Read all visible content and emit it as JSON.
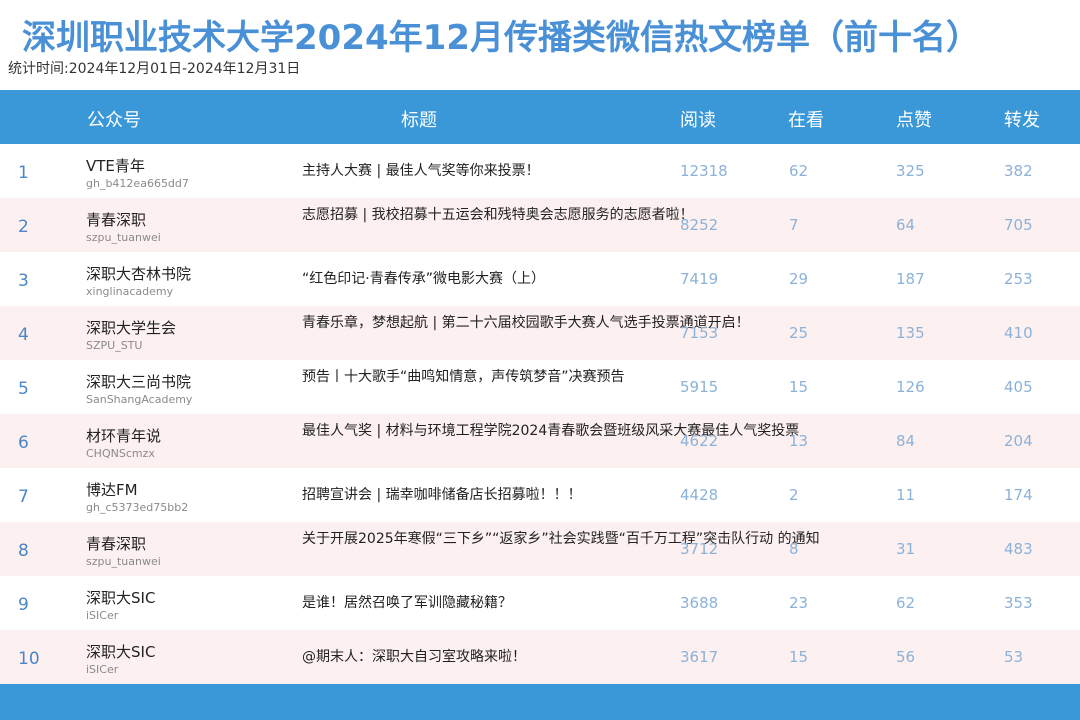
{
  "title": "深圳职业技术大学2024年12月传播类微信热文榜单（前十名）",
  "subtitle": "统计时间:2024年12月01日-2024年12月31日",
  "headers": {
    "account": "公众号",
    "article": "标题",
    "reads": "阅读",
    "watching": "在看",
    "likes": "点赞",
    "shares": "转发"
  },
  "rows": [
    {
      "rank": "1",
      "name": "VTE青年",
      "id": "gh_b412ea665dd7",
      "title": "主持人大赛 | 最佳人气奖等你来投票！",
      "reads": "12318",
      "watching": "62",
      "likes": "325",
      "shares": "382"
    },
    {
      "rank": "2",
      "name": "青春深职",
      "id": "szpu_tuanwei",
      "title": "志愿招募 | 我校招募十五运会和残特奥会志愿服务的志愿者啦！",
      "reads": "8252",
      "watching": "7",
      "likes": "64",
      "shares": "705"
    },
    {
      "rank": "3",
      "name": "深职大杏林书院",
      "id": "xinglinacademy",
      "title": "“红色印记·青春传承”微电影大赛（上）",
      "reads": "7419",
      "watching": "29",
      "likes": "187",
      "shares": "253"
    },
    {
      "rank": "4",
      "name": "深职大学生会",
      "id": "SZPU_STU",
      "title": "青春乐章，梦想起航 | 第二十六届校园歌手大赛人气选手投票通道开启！",
      "reads": "7153",
      "watching": "25",
      "likes": "135",
      "shares": "410"
    },
    {
      "rank": "5",
      "name": "深职大三尚书院",
      "id": "SanShangAcademy",
      "title": "预告丨十大歌手“曲鸣知情意，声传筑梦音”决赛预告",
      "reads": "5915",
      "watching": "15",
      "likes": "126",
      "shares": "405"
    },
    {
      "rank": "6",
      "name": "材环青年说",
      "id": "CHQNScmzx",
      "title": "最佳人气奖 | 材料与环境工程学院2024青春歌会暨班级风采大赛最佳人气奖投票",
      "reads": "4622",
      "watching": "13",
      "likes": "84",
      "shares": "204"
    },
    {
      "rank": "7",
      "name": "博达FM",
      "id": "gh_c5373ed75bb2",
      "title": "招聘宣讲会 | 瑞幸咖啡储备店长招募啦！！！",
      "reads": "4428",
      "watching": "2",
      "likes": "11",
      "shares": "174"
    },
    {
      "rank": "8",
      "name": "青春深职",
      "id": "szpu_tuanwei",
      "title": "关于开展2025年寒假“三下乡”“返家乡”社会实践暨“百千万工程”突击队行动 的通知",
      "reads": "3712",
      "watching": "8",
      "likes": "31",
      "shares": "483"
    },
    {
      "rank": "9",
      "name": "深职大SIC",
      "id": "iSICer",
      "title": "是谁！居然召唤了军训隐藏秘籍？",
      "reads": "3688",
      "watching": "23",
      "likes": "62",
      "shares": "353"
    },
    {
      "rank": "10",
      "name": "深职大SIC",
      "id": "iSICer",
      "title": "@期末人：深职大自习室攻略来啦！",
      "reads": "3617",
      "watching": "15",
      "likes": "56",
      "shares": "53"
    }
  ]
}
